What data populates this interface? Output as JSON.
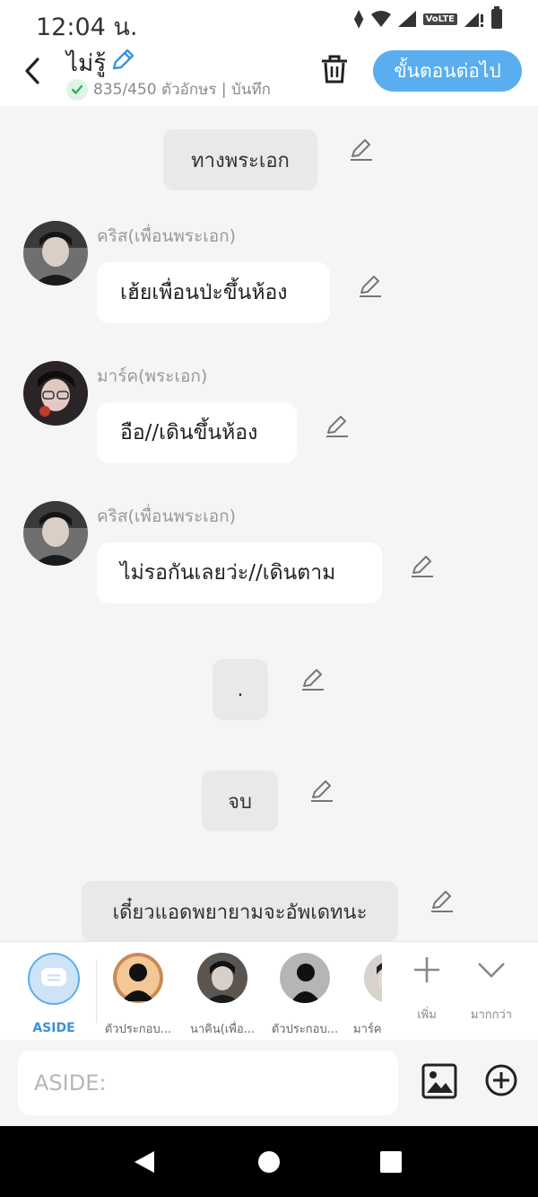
{
  "status_bar": {
    "time": "12:04 น.",
    "volte_label": "VoLTE"
  },
  "header": {
    "title": "ไม่รู้",
    "char_count": "835/450 ตัวอักษร | บันทึก",
    "next_button": "ขั้นตอนต่อไป"
  },
  "messages": [
    {
      "type": "narration",
      "text": "ทางพระเอก"
    },
    {
      "type": "character",
      "name": "คริส(เพื่อนพระเอก)",
      "text": "เฮ้ยเพื่อนป่ะขึ้นห้อง"
    },
    {
      "type": "character",
      "name": "มาร์ค(พระเอก)",
      "text": "อือ//เดินขึ้นห้อง"
    },
    {
      "type": "character",
      "name": "คริส(เพื่อนพระเอก)",
      "text": "ไม่รอกันเลยว่ะ//เดินตาม"
    },
    {
      "type": "narration",
      "text": "."
    },
    {
      "type": "narration",
      "text": "จบ"
    },
    {
      "type": "narration",
      "text": "เดี๋ยวแอดพยายามจะอัพเดทนะ"
    }
  ],
  "characters": [
    {
      "label": "ASIDE",
      "icon": "chat-bubble-icon"
    },
    {
      "label": "ตัวประกอบ..."
    },
    {
      "label": "นาคิน(เพื่อ..."
    },
    {
      "label": "ตัวประกอบ..."
    },
    {
      "label": "มาร์ค"
    }
  ],
  "tools": {
    "add_label": "เพิ่ม",
    "more_label": "มากกว่า"
  },
  "input": {
    "placeholder": "ASIDE:"
  },
  "colors": {
    "accent": "#5aaeef",
    "check": "#2ab55a"
  }
}
